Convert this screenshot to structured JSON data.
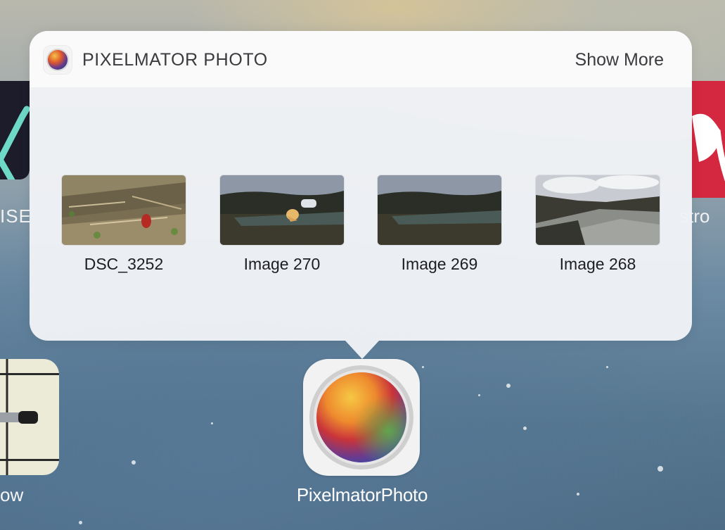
{
  "widget": {
    "title": "PIXELMATOR PHOTO",
    "show_more_label": "Show More",
    "thumbnails": [
      {
        "label": "DSC_3252"
      },
      {
        "label": "Image 270"
      },
      {
        "label": "Image 269"
      },
      {
        "label": "Image 268"
      }
    ]
  },
  "home": {
    "app_label": "PixelmatorPhoto",
    "bg_label_left_top": "ISE",
    "bg_label_right_top": "stro",
    "bg_label_left_bottom": "ow"
  },
  "icons": {
    "app_icon": "pixelmator-photo-icon"
  },
  "colors": {
    "widget_bg": "#f0f2f6",
    "text_primary": "#3b3b3f",
    "label_white": "#ffffff"
  }
}
